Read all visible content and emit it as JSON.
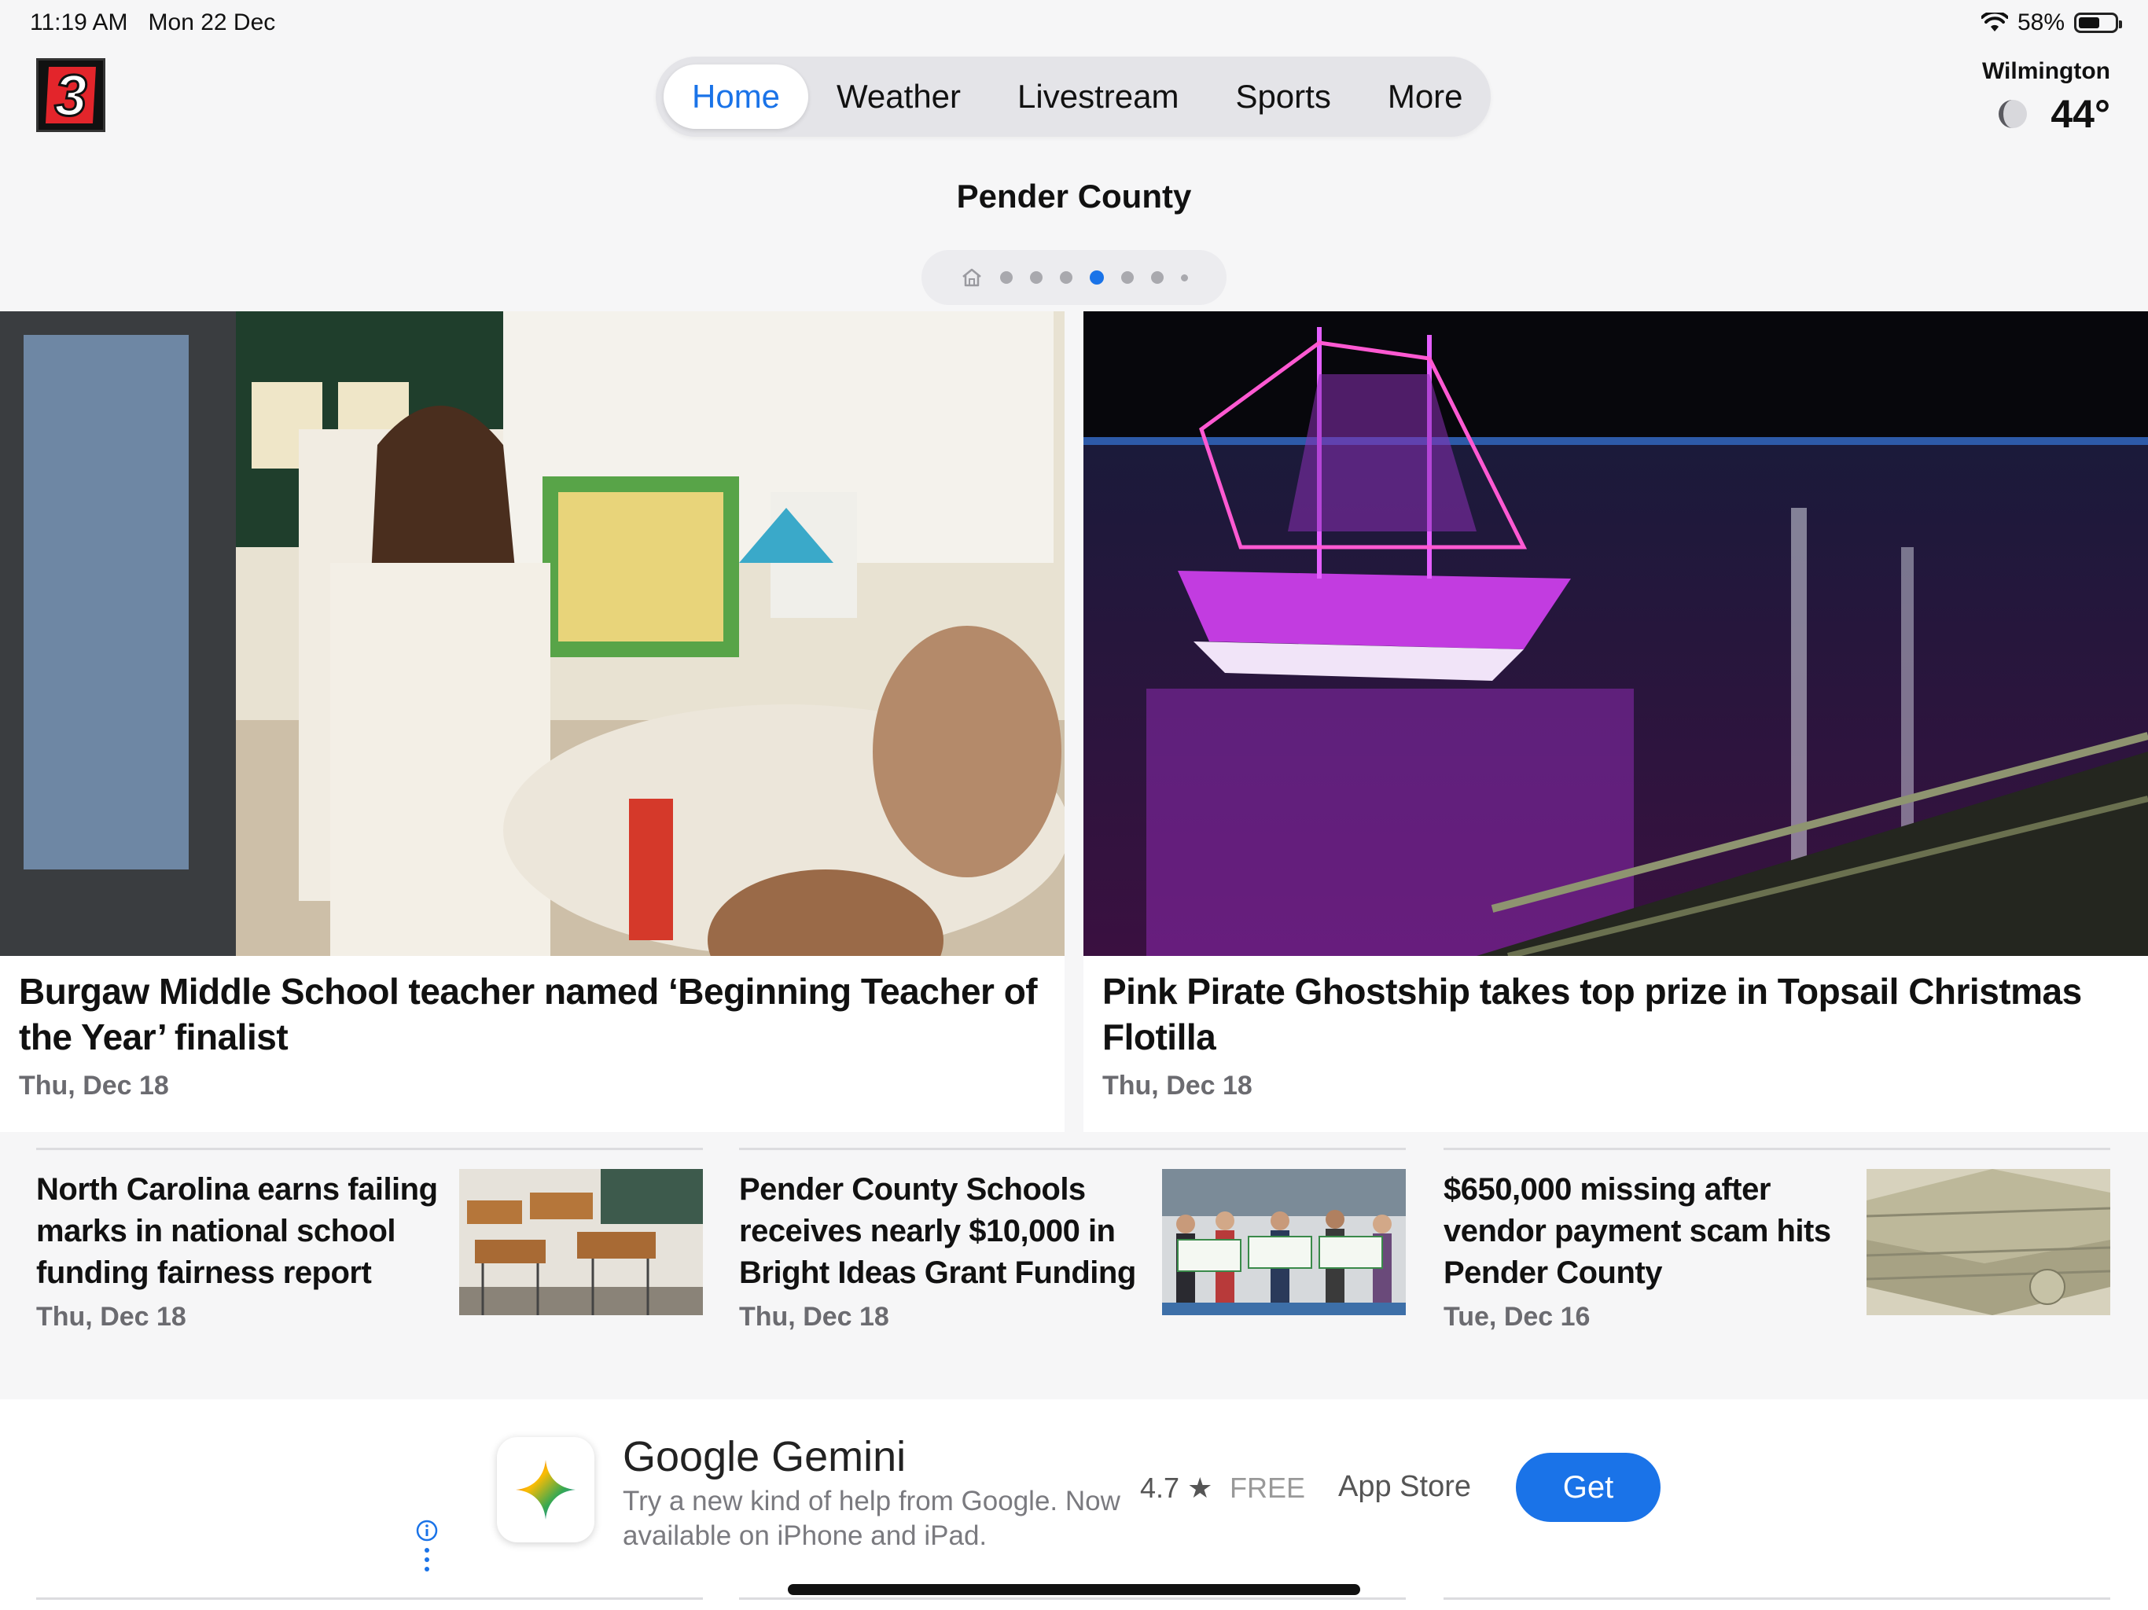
{
  "status_bar": {
    "time": "11:19 AM",
    "date": "Mon 22 Dec",
    "battery": "58%",
    "battery_level": 0.58,
    "icons": [
      "wifi-icon",
      "battery-icon"
    ]
  },
  "app": {
    "logo": "3",
    "logo_colors": {
      "red": "#e3252b",
      "white": "#ffffff"
    }
  },
  "nav": {
    "tabs": [
      {
        "label": "Home",
        "active": true
      },
      {
        "label": "Weather"
      },
      {
        "label": "Livestream"
      },
      {
        "label": "Sports"
      },
      {
        "label": "More"
      }
    ]
  },
  "weather": {
    "city": "Wilmington",
    "temp": "44°",
    "icon": "moon-icon"
  },
  "section": {
    "title": "Pender County",
    "pager_pages": 7,
    "active_page": 4
  },
  "hero_stories": [
    {
      "headline": "Burgaw Middle School teacher named ‘Beginning Teacher of the Year’ finalist",
      "date": "Thu, Dec 18"
    },
    {
      "headline": "Pink Pirate Ghostship takes top prize in Topsail Christmas Flotilla",
      "date": "Thu, Dec 18"
    }
  ],
  "stories": [
    {
      "headline": "North Carolina earns failing marks in national school funding fairness report",
      "date": "Thu, Dec 18"
    },
    {
      "headline": "Pender County Schools receives nearly $10,000 in Bright Ideas Grant Funding",
      "date": "Thu, Dec 18"
    },
    {
      "headline": "$650,000 missing after vendor payment scam hits Pender County",
      "date": "Tue, Dec 16"
    }
  ],
  "ad": {
    "title": "Google Gemini",
    "description": "Try a new kind of help from Google. Now available on iPhone and iPad.",
    "rating": "4.7",
    "price": "FREE",
    "store": "App Store",
    "button": "Get"
  },
  "colors": {
    "accent": "#1a73e8",
    "background": "#f6f6f7",
    "muted": "#6b6b70"
  }
}
